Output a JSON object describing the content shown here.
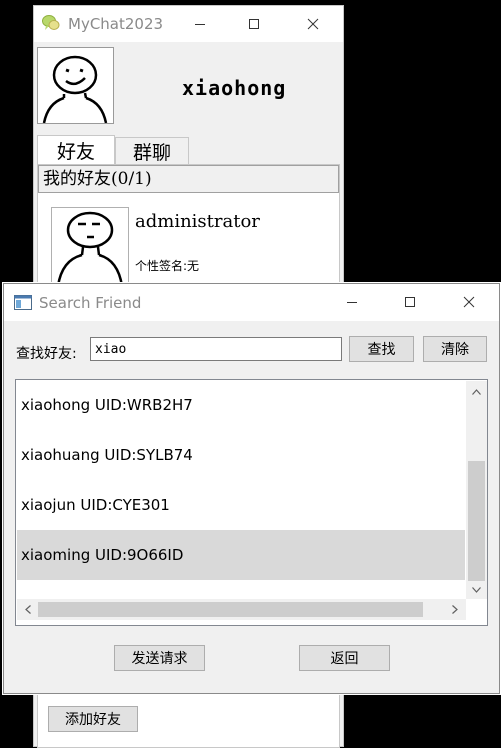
{
  "main_window": {
    "title": "MyChat2023",
    "username": "xiaohong",
    "tabs": [
      {
        "label": "好友"
      },
      {
        "label": "群聊"
      }
    ],
    "group_header": "我的好友(0/1)",
    "friend": {
      "name": "administrator",
      "signature": "个性签名:无"
    },
    "add_friend_button": "添加好友"
  },
  "search_dialog": {
    "title": "Search Friend",
    "search_label": "查找好友:",
    "search_value": "xiao",
    "search_button": "查找",
    "clear_button": "清除",
    "results": [
      {
        "text": "xiaohong  UID:WRB2H7",
        "selected": false
      },
      {
        "text": "xiaohuang  UID:SYLB74",
        "selected": false
      },
      {
        "text": "xiaojun  UID:CYE301",
        "selected": false
      },
      {
        "text": "xiaoming  UID:9O66ID",
        "selected": true
      }
    ],
    "send_request_button": "发送请求",
    "back_button": "返回"
  },
  "icons": {
    "window_minimize": "minimize-icon",
    "window_maximize": "maximize-icon",
    "window_close": "close-icon",
    "app": "chat-bubble-icon"
  },
  "colors": {
    "selection": "#d9d9d9",
    "title_text": "#8a8a8a",
    "button_face": "#e1e1e1"
  }
}
